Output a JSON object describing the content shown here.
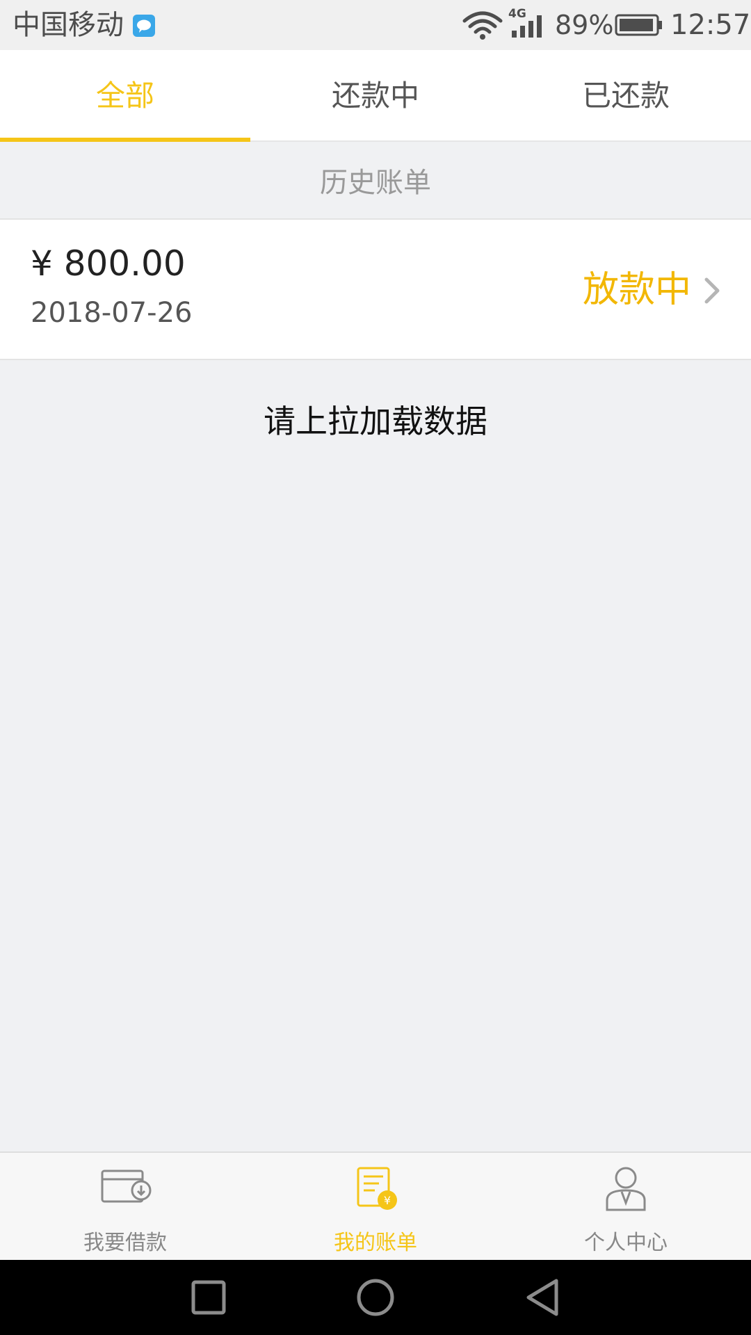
{
  "status_bar": {
    "carrier": "中国移动",
    "network": "4G",
    "battery": "89%",
    "time": "12:57"
  },
  "tabs": [
    {
      "label": "全部",
      "active": true
    },
    {
      "label": "还款中",
      "active": false
    },
    {
      "label": "已还款",
      "active": false
    }
  ],
  "section_title": "历史账单",
  "bill": {
    "amount": "¥ 800.00",
    "date": "2018-07-26",
    "status": "放款中"
  },
  "load_hint": "请上拉加载数据",
  "bottom_nav": [
    {
      "label": "我要借款",
      "icon": "wallet-icon",
      "active": false
    },
    {
      "label": "我的账单",
      "icon": "bill-icon",
      "active": true
    },
    {
      "label": "个人中心",
      "icon": "person-icon",
      "active": false
    }
  ],
  "colors": {
    "accent": "#f5c518",
    "status_pending": "#f2b705",
    "background": "#f0f1f3"
  }
}
